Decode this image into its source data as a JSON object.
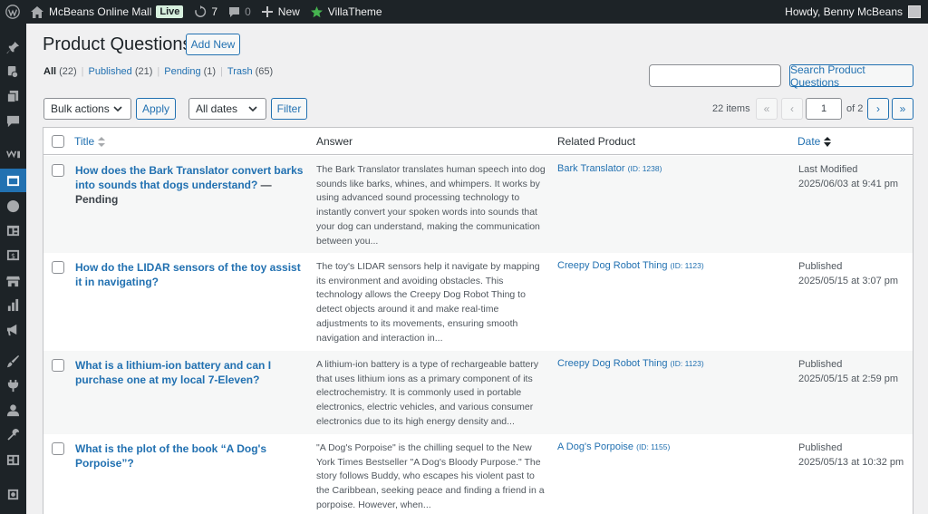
{
  "admin_bar": {
    "site_name": "McBeans Online Mall",
    "live_badge": "Live",
    "updates_count": "7",
    "comments_count": "0",
    "new_label": "New",
    "villatheme_label": "VillaTheme",
    "howdy": "Howdy, Benny McBeans"
  },
  "page": {
    "title": "Product Questions",
    "add_new": "Add New"
  },
  "views": [
    {
      "label": "All",
      "count": "(22)"
    },
    {
      "label": "Published",
      "count": "(21)"
    },
    {
      "label": "Pending",
      "count": "(1)"
    },
    {
      "label": "Trash",
      "count": "(65)"
    }
  ],
  "search": {
    "value": "",
    "button": "Search Product Questions"
  },
  "toolbar": {
    "bulk_actions": "Bulk actions",
    "apply": "Apply",
    "all_dates": "All dates",
    "filter": "Filter",
    "items_count": "22 items",
    "first_page": "«",
    "prev_page": "‹",
    "current_page": "1",
    "of_pages": "of 2",
    "next_page": "›",
    "last_page": "»"
  },
  "table": {
    "headers": {
      "title": "Title",
      "answer": "Answer",
      "product": "Related Product",
      "date": "Date"
    },
    "rows": [
      {
        "title": "How does the Bark Translator convert barks into sounds that dogs understand?",
        "state": " — Pending",
        "answer": "The Bark Translator translates human speech into dog sounds like barks, whines, and whimpers. It works by using advanced sound processing technology to instantly convert your spoken words into sounds that your dog can understand, making the communication between you...",
        "product": "Bark Translator",
        "product_id": "(ID: 1238)",
        "date_status": "Last Modified",
        "date": "2025/06/03 at 9:41 pm"
      },
      {
        "title": "How do the LIDAR sensors of the toy assist it in navigating?",
        "state": "",
        "answer": "The toy's LIDAR sensors help it navigate by mapping its environment and avoiding obstacles. This technology allows the Creepy Dog Robot Thing to detect objects around it and make real-time adjustments to its movements, ensuring smooth navigation and interaction in...",
        "product": "Creepy Dog Robot Thing",
        "product_id": "(ID: 1123)",
        "date_status": "Published",
        "date": "2025/05/15 at 3:07 pm"
      },
      {
        "title": "What is a lithium-ion battery and can I purchase one at my local 7-Eleven?",
        "state": "",
        "answer": "A lithium-ion battery is a type of rechargeable battery that uses lithium ions as a primary component of its electrochemistry. It is commonly used in portable electronics, electric vehicles, and various consumer electronics due to its high energy density and...",
        "product": "Creepy Dog Robot Thing",
        "product_id": "(ID: 1123)",
        "date_status": "Published",
        "date": "2025/05/15 at 2:59 pm"
      },
      {
        "title": "What is the plot of the book “A Dog's Porpoise”?",
        "state": "",
        "answer": "\"A Dog's Porpoise\" is the chilling sequel to the New York Times Bestseller \"A Dog's Bloody Purpose.\" The story follows Buddy, who escapes his violent past to the Caribbean, seeking peace and finding a friend in a porpoise. However, when...",
        "product": "A Dog's Porpoise",
        "product_id": "(ID: 1155)",
        "date_status": "Published",
        "date": "2025/05/13 at 10:32 pm"
      }
    ]
  },
  "colors": {
    "accent": "#2271b1",
    "adminbar_bg": "#1d2327",
    "live_badge_bg": "#d7f0de"
  }
}
